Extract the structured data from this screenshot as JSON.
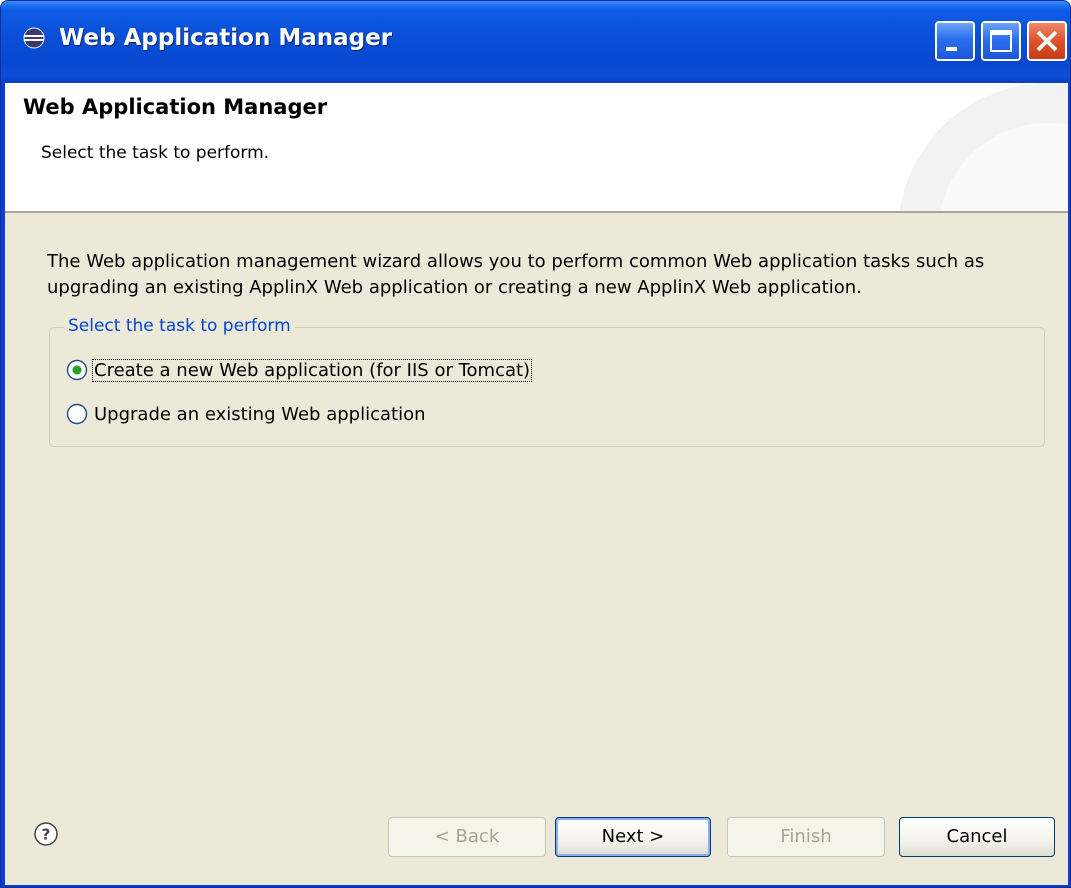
{
  "window": {
    "title": "Web Application Manager"
  },
  "header": {
    "title": "Web Application Manager",
    "subtitle": "Select the task to perform."
  },
  "body": {
    "description": "The Web application management wizard allows you to perform common Web application tasks such as upgrading an existing ApplinX Web application or creating a new ApplinX Web application.",
    "group": {
      "label": "Select the task to perform",
      "options": [
        {
          "label": "Create a new Web application (for IIS or Tomcat)",
          "selected": true
        },
        {
          "label": "Upgrade an existing Web application",
          "selected": false
        }
      ]
    }
  },
  "buttons": {
    "back": "< Back",
    "next": "Next >",
    "finish": "Finish",
    "cancel": "Cancel"
  },
  "colors": {
    "titlebar": "#0a50d8",
    "body_bg": "#ece9d8",
    "group_label": "#0046d5",
    "radio_selected": "#21a121"
  },
  "icons": {
    "title": "eclipse-icon",
    "help": "help-icon"
  }
}
